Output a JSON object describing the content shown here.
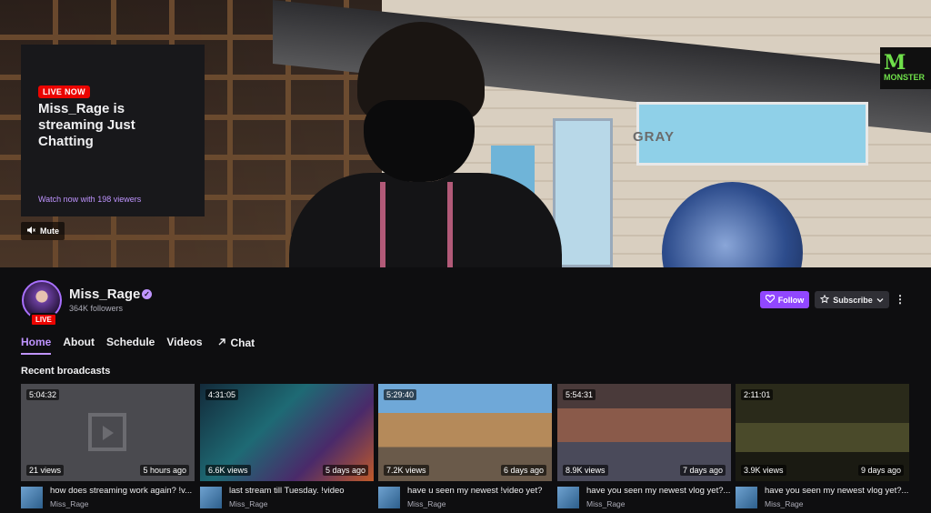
{
  "player": {
    "live_badge": "LIVE NOW",
    "title": "Miss_Rage is streaming Just Chatting",
    "watch_text": "Watch now with 198 viewers",
    "mute_label": "Mute",
    "background_sign": "GRAY",
    "sponsor_logo": "MONSTER"
  },
  "channel": {
    "name": "Miss_Rage",
    "followers": "364K followers",
    "avatar_live_badge": "LIVE",
    "verified_icon": "verified-checkmark",
    "follow_label": "Follow",
    "subscribe_label": "Subscribe",
    "colors": {
      "accent": "#9147ff",
      "live": "#eb0400"
    }
  },
  "tabs": [
    {
      "label": "Home",
      "active": true
    },
    {
      "label": "About",
      "active": false
    },
    {
      "label": "Schedule",
      "active": false
    },
    {
      "label": "Videos",
      "active": false
    },
    {
      "label": "Chat",
      "active": false
    }
  ],
  "recent": {
    "section_title": "Recent broadcasts",
    "cards": [
      {
        "duration": "5:04:32",
        "views": "21 views",
        "ago": "5 hours ago",
        "title": "how does streaming work again? !v...",
        "channel": "Miss_Rage"
      },
      {
        "duration": "4:31:05",
        "views": "6.6K views",
        "ago": "5 days ago",
        "title": "last stream till Tuesday. !video",
        "channel": "Miss_Rage"
      },
      {
        "duration": "5:29:40",
        "views": "7.2K views",
        "ago": "6 days ago",
        "title": "have u seen my newest !video yet?",
        "channel": "Miss_Rage"
      },
      {
        "duration": "5:54:31",
        "views": "8.9K views",
        "ago": "7 days ago",
        "title": "have you seen my newest vlog yet?...",
        "channel": "Miss_Rage"
      },
      {
        "duration": "2:11:01",
        "views": "3.9K views",
        "ago": "9 days ago",
        "title": "have you seen my newest vlog yet?...",
        "channel": "Miss_Rage"
      }
    ]
  }
}
